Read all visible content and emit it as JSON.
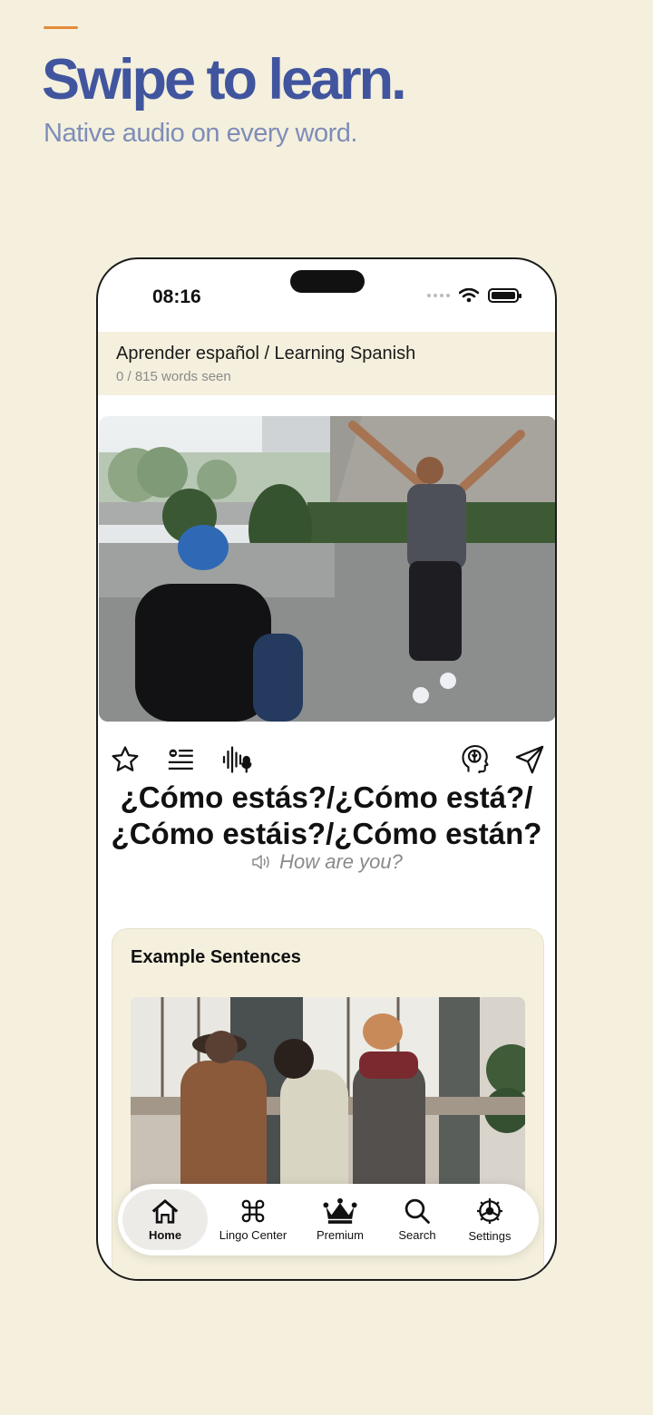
{
  "promo": {
    "headline": "Swipe to learn.",
    "subheadline": "Native audio on every word."
  },
  "status_bar": {
    "time": "08:16"
  },
  "deck": {
    "title": "Aprender español / Learning Spanish",
    "progress": "0 / 815 words seen"
  },
  "card": {
    "word_line1": "¿Cómo estás?/¿Cómo está?/",
    "word_line2": "¿Cómo estáis?/¿Cómo están?",
    "translation": "How are you?",
    "actions": [
      "star-icon",
      "list-icon",
      "audio-waveform-icon",
      "brain-icon",
      "send-icon"
    ]
  },
  "examples": {
    "title": "Example Sentences"
  },
  "tabs": [
    {
      "label": "Home",
      "icon": "home-icon",
      "active": true
    },
    {
      "label": "Lingo Center",
      "icon": "command-icon",
      "active": false
    },
    {
      "label": "Premium",
      "icon": "crown-icon",
      "active": false
    },
    {
      "label": "Search",
      "icon": "search-icon",
      "active": false
    },
    {
      "label": "Settings",
      "icon": "gear-icon",
      "active": false
    }
  ],
  "colors": {
    "background": "#f4f0dd",
    "headline": "#41559f",
    "subheadline": "#7f8db8",
    "accent": "#e58a3a"
  }
}
